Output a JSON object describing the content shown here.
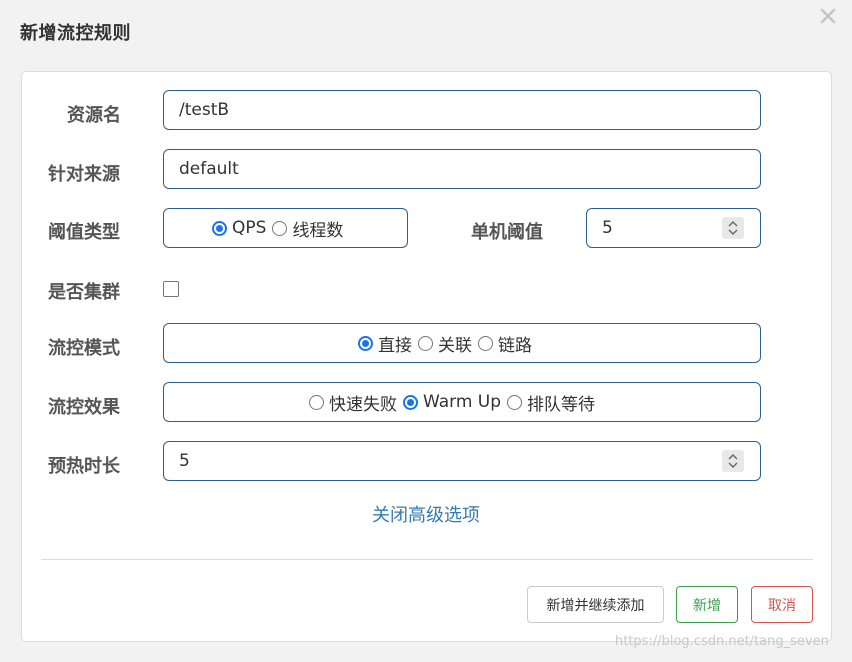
{
  "dialog": {
    "title": "新增流控规则",
    "close_icon": "close-icon"
  },
  "form": {
    "resource": {
      "label": "资源名",
      "value": "/testB"
    },
    "origin": {
      "label": "针对来源",
      "value": "default"
    },
    "threshold_type": {
      "label": "阈值类型",
      "options": [
        "QPS",
        "线程数"
      ],
      "selected": "QPS"
    },
    "single_threshold": {
      "label": "单机阈值",
      "value": "5"
    },
    "cluster": {
      "label": "是否集群",
      "checked": false
    },
    "flow_mode": {
      "label": "流控模式",
      "options": [
        "直接",
        "关联",
        "链路"
      ],
      "selected": "直接"
    },
    "flow_effect": {
      "label": "流控效果",
      "options": [
        "快速失败",
        "Warm Up",
        "排队等待"
      ],
      "selected": "Warm Up"
    },
    "warmup_period": {
      "label": "预热时长",
      "value": "5"
    },
    "advanced_link": "关闭高级选项"
  },
  "footer": {
    "add_continue": "新增并继续添加",
    "add": "新增",
    "cancel": "取消"
  },
  "watermark": "https://blog.csdn.net/tang_seven",
  "colors": {
    "accent": "#1a73e8",
    "input_border": "#2f5f8e",
    "link": "#337ab7",
    "success": "#3c9e4d",
    "danger": "#d9534f"
  }
}
